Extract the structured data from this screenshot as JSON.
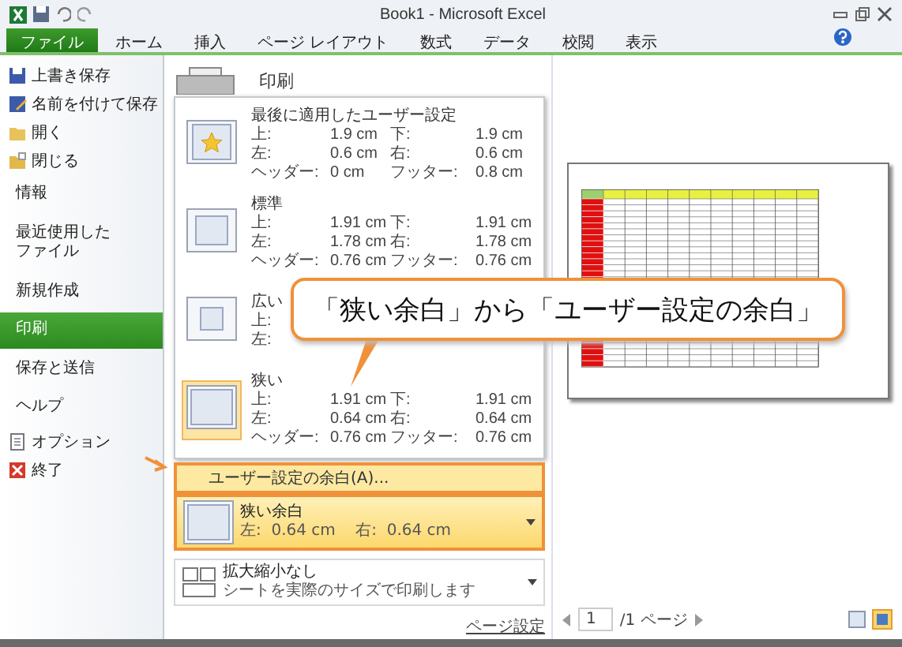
{
  "window": {
    "title": "Book1 - Microsoft Excel"
  },
  "ribbon_tabs": [
    {
      "label": "ファイル",
      "selected": true
    },
    {
      "label": "ホーム",
      "selected": false
    },
    {
      "label": "挿入",
      "selected": false
    },
    {
      "label": "ページ レイアウト",
      "selected": false
    },
    {
      "label": "数式",
      "selected": false
    },
    {
      "label": "データ",
      "selected": false
    },
    {
      "label": "校閲",
      "selected": false
    },
    {
      "label": "表示",
      "selected": false
    }
  ],
  "sidebar": {
    "items": [
      {
        "label": "上書き保存",
        "kind": "command",
        "selected": false
      },
      {
        "label": "名前を付けて保存",
        "kind": "command",
        "selected": false
      },
      {
        "label": "開く",
        "kind": "command",
        "selected": false
      },
      {
        "label": "閉じる",
        "kind": "command",
        "selected": false
      },
      {
        "label": "情報",
        "kind": "section",
        "selected": false
      },
      {
        "label": "最近使用したファイル",
        "kind": "section",
        "selected": false
      },
      {
        "label": "新規作成",
        "kind": "section",
        "selected": false
      },
      {
        "label": "印刷",
        "kind": "section",
        "selected": true
      },
      {
        "label": "保存と送信",
        "kind": "section",
        "selected": false
      },
      {
        "label": "ヘルプ",
        "kind": "section",
        "selected": false
      },
      {
        "label": "オプション",
        "kind": "command",
        "selected": false
      },
      {
        "label": "終了",
        "kind": "command",
        "selected": false
      }
    ]
  },
  "print_panel": {
    "heading": "印刷",
    "margin_options": [
      {
        "name": "最後に適用したユーザー設定",
        "kind": "custom",
        "selected": false,
        "rows": [
          [
            "上:",
            "1.9 cm",
            "下:",
            "1.9 cm"
          ],
          [
            "左:",
            "0.6 cm",
            "右:",
            "0.6 cm"
          ],
          [
            "ヘッダー:",
            "0 cm",
            "フッター:",
            "0.8 cm"
          ]
        ]
      },
      {
        "name": "標準",
        "kind": "normal",
        "selected": false,
        "rows": [
          [
            "上:",
            "1.91 cm",
            "下:",
            "1.91 cm"
          ],
          [
            "左:",
            "1.78 cm",
            "右:",
            "1.78 cm"
          ],
          [
            "ヘッダー:",
            "0.76 cm",
            "フッター:",
            "0.76 cm"
          ]
        ]
      },
      {
        "name": "広い",
        "kind": "wide",
        "selected": false,
        "rows": [
          [
            "上:"
          ],
          [
            "左:"
          ]
        ]
      },
      {
        "name": "狭い",
        "kind": "narrow",
        "selected": true,
        "rows": [
          [
            "上:",
            "1.91 cm",
            "下:",
            "1.91 cm"
          ],
          [
            "左:",
            "0.64 cm",
            "右:",
            "0.64 cm"
          ],
          [
            "ヘッダー:",
            "0.76 cm",
            "フッター:",
            "0.76 cm"
          ]
        ]
      }
    ],
    "custom_margins_link": "ユーザー設定の余白(A)...",
    "current_margins": {
      "title": "狭い余白",
      "detail": "左:  0.64 cm    右:  0.64 cm"
    },
    "scaling": {
      "title": "拡大縮小なし",
      "detail": "シートを実際のサイズで印刷します"
    },
    "page_setup_link": "ページ設定"
  },
  "preview": {
    "page": "1",
    "total": "/1 ページ"
  },
  "callout": "「狭い余白」から「ユーザー設定の余白」"
}
